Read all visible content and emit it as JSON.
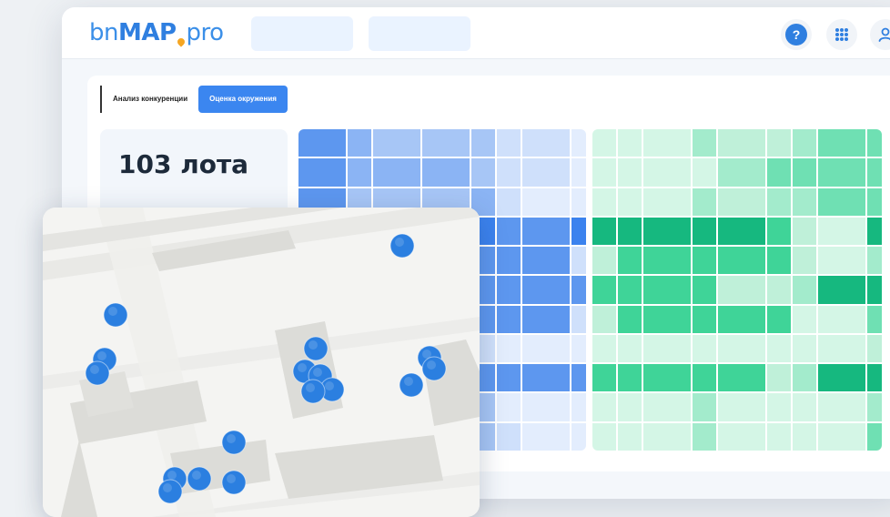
{
  "logo": {
    "part1": "bn",
    "part2": "MAP",
    "part3": "pro"
  },
  "header": {
    "help_label": "?"
  },
  "tabs": [
    {
      "label": "Анализ конкуренции",
      "active": false
    },
    {
      "label": "Оценка окружения",
      "active": true
    }
  ],
  "stat": {
    "value": "103 лота"
  },
  "colors": {
    "accent": "#3b86f0",
    "blue_scale": [
      "#e3edfd",
      "#cfe0fb",
      "#a7c6f6",
      "#8bb4f4",
      "#5d97ef",
      "#3b82ee"
    ],
    "green_scale": [
      "#d4f6e6",
      "#bff0d9",
      "#a3ebcc",
      "#6fe0b3",
      "#3fd498",
      "#16b87f"
    ]
  },
  "blue_heatmap": [
    [
      4,
      3,
      2,
      2,
      2,
      1,
      1,
      0
    ],
    [
      4,
      3,
      3,
      3,
      2,
      1,
      1,
      0
    ],
    [
      4,
      2,
      2,
      2,
      3,
      1,
      0,
      0
    ],
    [
      5,
      5,
      5,
      5,
      5,
      4,
      4,
      5
    ],
    [
      4,
      4,
      4,
      4,
      4,
      4,
      4,
      1
    ],
    [
      4,
      4,
      4,
      4,
      4,
      4,
      4,
      4
    ],
    [
      4,
      4,
      4,
      4,
      4,
      4,
      4,
      1
    ],
    [
      1,
      1,
      1,
      1,
      1,
      0,
      0,
      0
    ],
    [
      4,
      4,
      4,
      4,
      4,
      4,
      4,
      4
    ],
    [
      1,
      1,
      1,
      1,
      2,
      0,
      0,
      0
    ],
    [
      1,
      1,
      1,
      1,
      2,
      1,
      0,
      0
    ]
  ],
  "green_heatmap": [
    [
      0,
      0,
      0,
      2,
      1,
      1,
      2,
      3,
      3
    ],
    [
      0,
      0,
      0,
      0,
      2,
      3,
      3,
      3,
      3
    ],
    [
      0,
      0,
      0,
      2,
      1,
      2,
      2,
      3,
      3
    ],
    [
      5,
      5,
      5,
      5,
      5,
      4,
      1,
      0,
      5
    ],
    [
      1,
      4,
      4,
      4,
      4,
      4,
      1,
      0,
      2
    ],
    [
      4,
      4,
      4,
      4,
      1,
      1,
      2,
      5,
      5
    ],
    [
      1,
      4,
      4,
      4,
      4,
      4,
      0,
      0,
      3
    ],
    [
      0,
      0,
      0,
      0,
      0,
      0,
      0,
      0,
      1
    ],
    [
      4,
      4,
      4,
      4,
      4,
      1,
      2,
      5,
      5
    ],
    [
      0,
      0,
      0,
      2,
      0,
      0,
      0,
      0,
      2
    ],
    [
      0,
      0,
      0,
      2,
      0,
      0,
      0,
      0,
      3
    ]
  ],
  "map": {
    "marker_color": "#2b7fe0"
  }
}
